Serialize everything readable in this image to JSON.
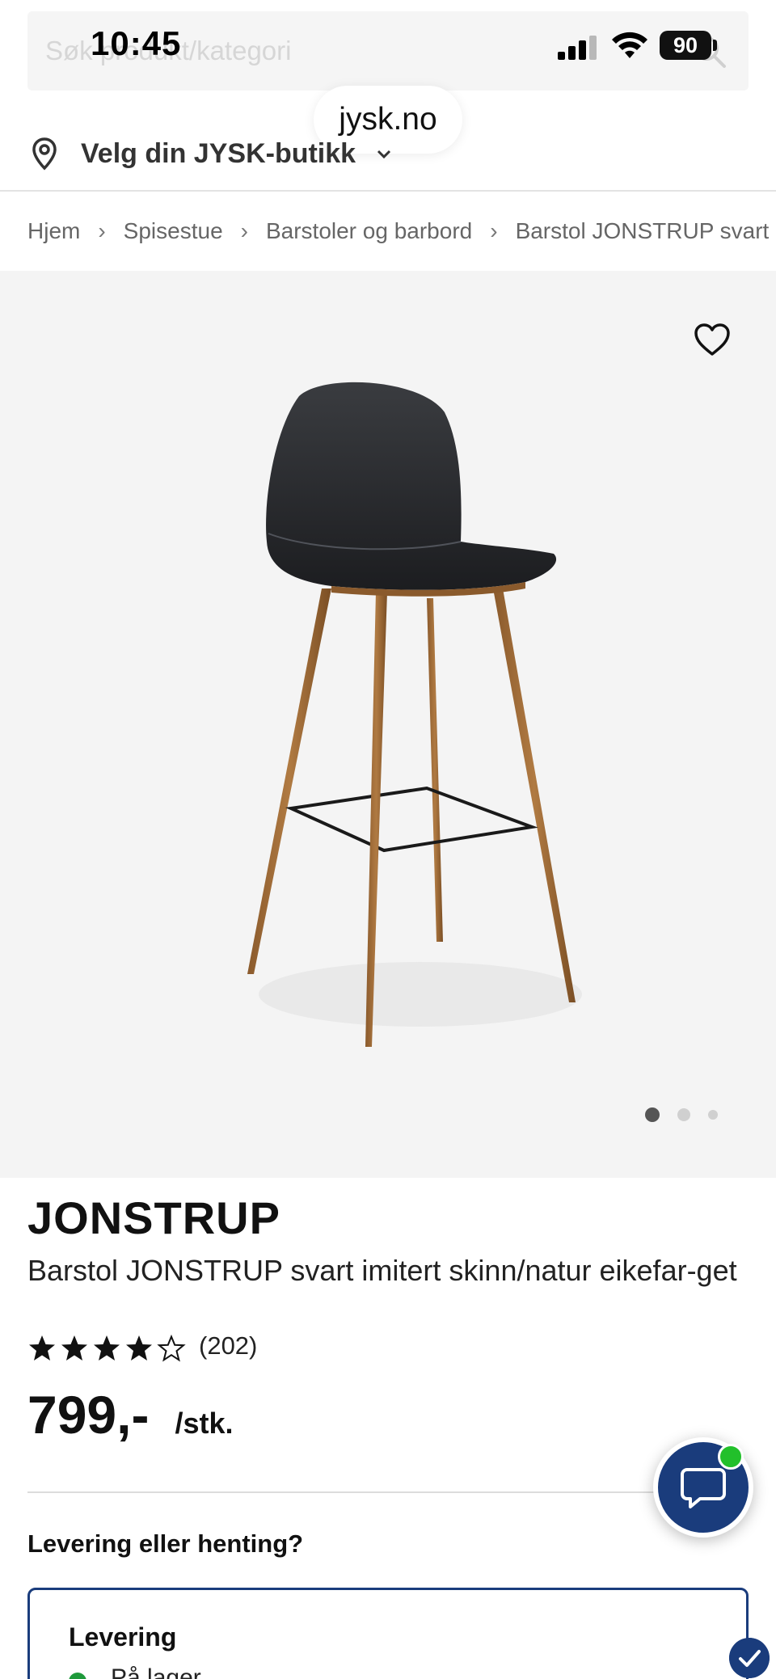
{
  "status_bar": {
    "time": "10:45",
    "battery": "90"
  },
  "search": {
    "placeholder": "Søk produkt/kategori",
    "visible_placeholder": "Søk p      t/kategori"
  },
  "browser": {
    "url": "jysk.no"
  },
  "store_picker": {
    "label": "Velg din JYSK-butikk",
    "icon": "location-pin-icon"
  },
  "breadcrumb": [
    "Hjem",
    "Spisestue",
    "Barstoler og barbord",
    "Barstol JONSTRUP svart"
  ],
  "gallery": {
    "image_count": 3,
    "active_index": 0,
    "favorite_icon": "heart-icon"
  },
  "product": {
    "brand": "JONSTRUP",
    "description": "Barstol JONSTRUP svart imitert skinn/natur eikefar-get",
    "rating": 4,
    "rating_max": 5,
    "review_count": "(202)",
    "price": "799,-",
    "unit": "/stk."
  },
  "delivery": {
    "heading": "Levering eller henting?",
    "card_title": "Levering",
    "stock_text": "På lager"
  },
  "colors": {
    "brand_blue": "#1a3c7c",
    "online_green": "#22c02b",
    "stock_green": "#1f9a3b",
    "image_bg": "#f4f4f4"
  }
}
